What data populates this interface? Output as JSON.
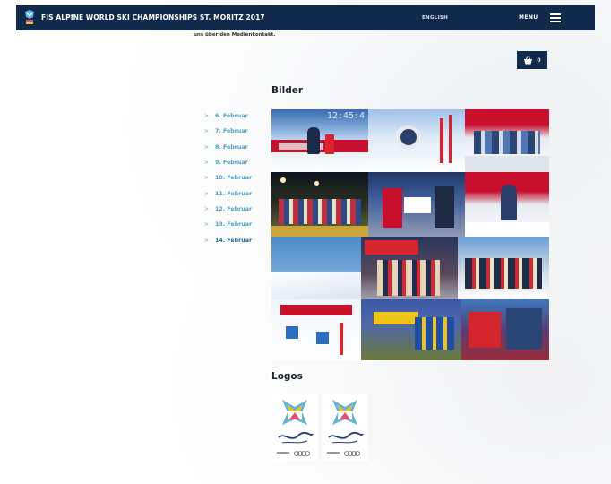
{
  "header": {
    "title": "FIS ALPINE WORLD SKI CHAMPIONSHIPS ST. MORITZ 2017",
    "language": "ENGLISH",
    "menu": "MENU"
  },
  "intro": {
    "text": "uns über den Medienkontakt."
  },
  "cart": {
    "count": "0"
  },
  "sections": {
    "images_heading": "Bilder",
    "logos_heading": "Logos"
  },
  "date_nav": {
    "items": [
      "6. Februar",
      "7. Februar",
      "8. Februar",
      "9. Februar",
      "10. Februar",
      "11. Februar",
      "12. Februar",
      "13. Februar",
      "14. Februar"
    ],
    "active_index": 8
  },
  "gallery": {
    "clock": "12:45:4"
  },
  "colors": {
    "navy": "#0f2a4a",
    "link": "#4f9fbf",
    "link_active": "#1a6a8c"
  }
}
